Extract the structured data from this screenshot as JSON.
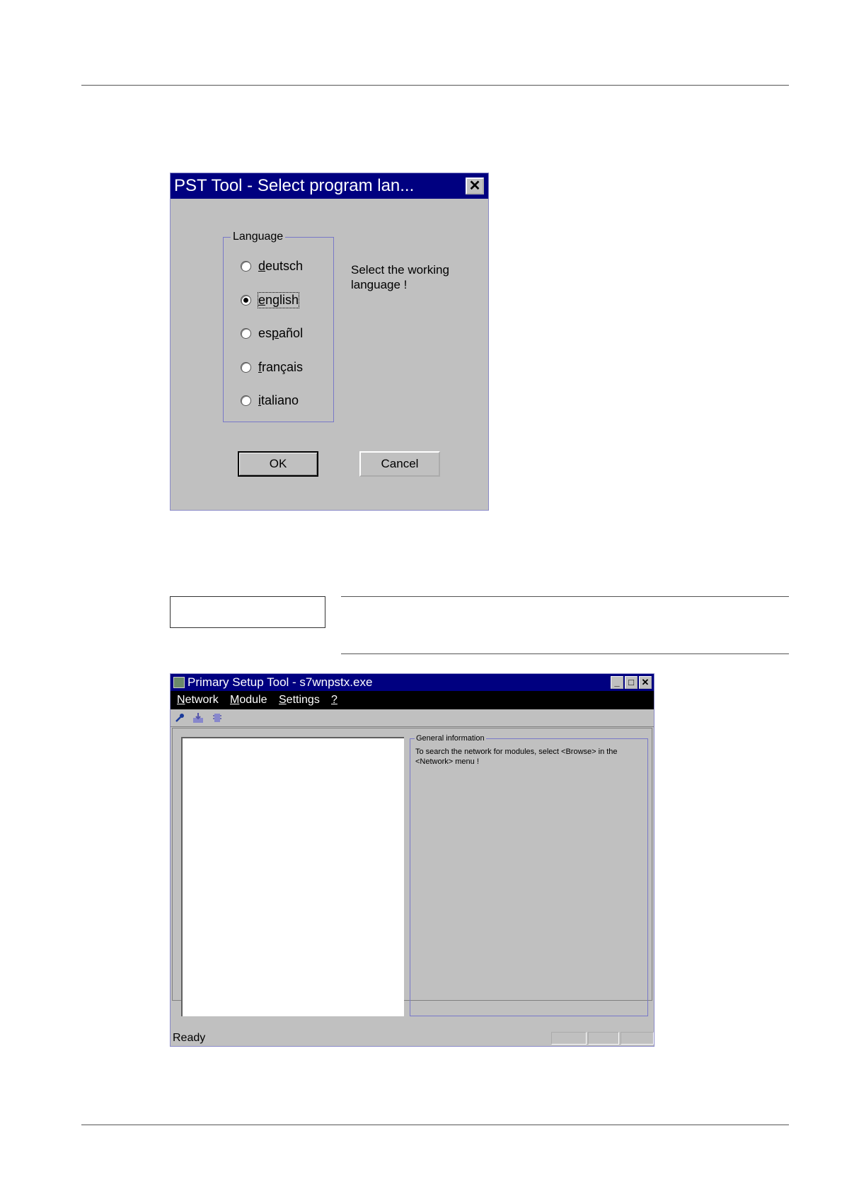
{
  "dialog": {
    "title": "PST Tool -  Select program lan...",
    "close_label": "✕",
    "group_label": "Language",
    "languages": [
      {
        "prefix": "",
        "accel": "d",
        "rest": "eutsch",
        "selected": false
      },
      {
        "prefix": "",
        "accel": "e",
        "rest": "nglish",
        "selected": true
      },
      {
        "prefix": "es",
        "accel": "p",
        "rest": "añol",
        "selected": false
      },
      {
        "prefix": "",
        "accel": "f",
        "rest": "rançais",
        "selected": false
      },
      {
        "prefix": "",
        "accel": "i",
        "rest": "taliano",
        "selected": false
      }
    ],
    "hint": "Select the working language !",
    "ok_label": "OK",
    "cancel_label": "Cancel"
  },
  "window": {
    "title": "Primary Setup Tool - s7wnpstx.exe",
    "controls": {
      "minimize": "_",
      "maximize": "□",
      "close": "✕"
    },
    "menus": [
      {
        "accel": "N",
        "rest": "etwork"
      },
      {
        "accel": "M",
        "rest": "odule"
      },
      {
        "accel": "S",
        "rest": "ettings"
      },
      {
        "accel": "?",
        "rest": ""
      }
    ],
    "info_legend": "General information",
    "info_text": "To search the network for modules, select <Browse> in the <Network> menu !",
    "status": "Ready"
  }
}
